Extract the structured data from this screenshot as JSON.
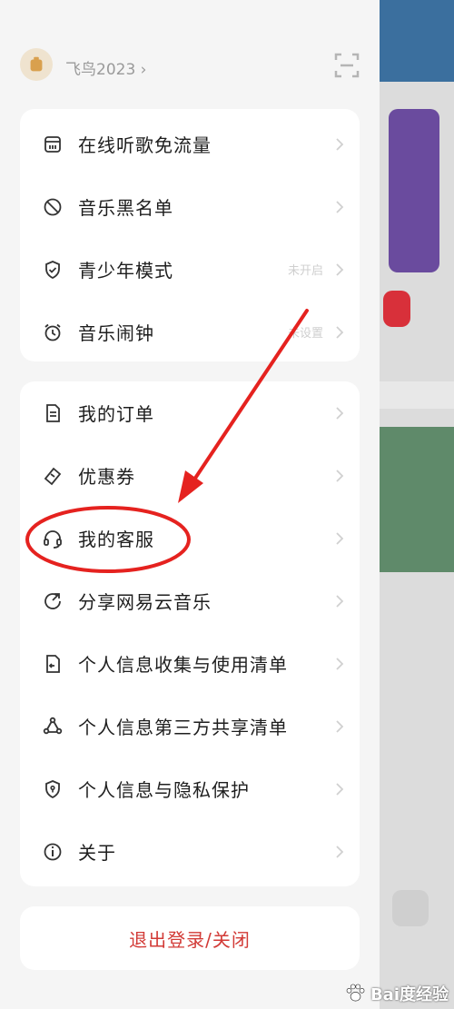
{
  "header": {
    "username": "飞鸟2023 ›"
  },
  "card1": [
    {
      "name": "free-streaming",
      "label": "在线听歌免流量",
      "icon": "sim-card-icon",
      "sub": ""
    },
    {
      "name": "blacklist",
      "label": "音乐黑名单",
      "icon": "block-icon",
      "sub": ""
    },
    {
      "name": "teen-mode",
      "label": "青少年模式",
      "icon": "shield-check-icon",
      "sub": "未开启"
    },
    {
      "name": "alarm",
      "label": "音乐闹钟",
      "icon": "alarm-clock-icon",
      "sub": "未设置"
    }
  ],
  "card2": [
    {
      "name": "my-orders",
      "label": "我的订单",
      "icon": "document-icon"
    },
    {
      "name": "coupons",
      "label": "优惠券",
      "icon": "ticket-icon"
    },
    {
      "name": "customer-service",
      "label": "我的客服",
      "icon": "headset-icon"
    },
    {
      "name": "share-app",
      "label": "分享网易云音乐",
      "icon": "share-icon"
    },
    {
      "name": "info-collection-list",
      "label": "个人信息收集与使用清单",
      "icon": "file-export-icon"
    },
    {
      "name": "third-party-sharing-list",
      "label": "个人信息第三方共享清单",
      "icon": "share-nodes-icon"
    },
    {
      "name": "privacy-protection",
      "label": "个人信息与隐私保护",
      "icon": "privacy-shield-icon"
    },
    {
      "name": "about",
      "label": "关于",
      "icon": "info-icon"
    }
  ],
  "logout": {
    "label": "退出登录/关闭"
  },
  "watermark": {
    "text": "Bai度经验"
  },
  "colors": {
    "accent": "#d23a36",
    "annotation": "#e5221f"
  }
}
